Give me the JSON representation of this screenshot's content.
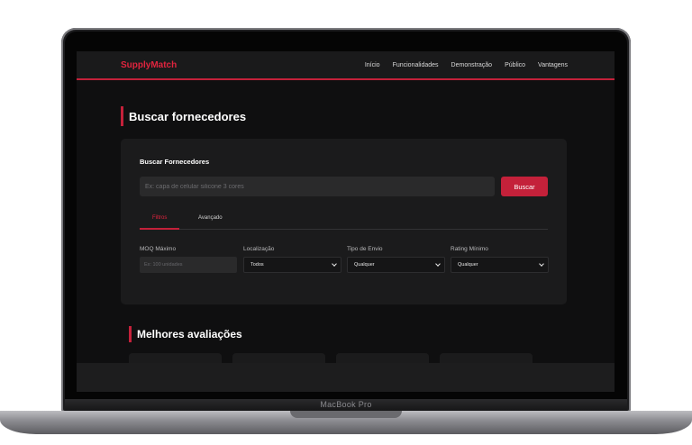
{
  "device": {
    "label": "MacBook Pro"
  },
  "navbar": {
    "brand": "SupplyMatch",
    "links": [
      "Início",
      "Funcionalidades",
      "Demonstração",
      "Público",
      "Vantagens"
    ]
  },
  "search_section": {
    "title": "Buscar fornecedores",
    "card_title": "Buscar Fornecedores",
    "search_placeholder": "Ex: capa de celular silicone 3 cores",
    "search_button": "Buscar",
    "tabs": [
      {
        "label": "Filtros",
        "active": true
      },
      {
        "label": "Avançado",
        "active": false
      }
    ],
    "filters": {
      "moq": {
        "label": "MOQ Máximo",
        "placeholder": "Ex: 100 unidades"
      },
      "location": {
        "label": "Localização",
        "value": "Todos"
      },
      "shipping": {
        "label": "Tipo de Envio",
        "value": "Qualquer"
      },
      "rating": {
        "label": "Rating Mínimo",
        "value": "Qualquer"
      }
    }
  },
  "reviews_section": {
    "title": "Melhores avaliações"
  },
  "colors": {
    "accent": "#c4213a",
    "background": "#0f0f10",
    "card": "#1b1b1c"
  }
}
